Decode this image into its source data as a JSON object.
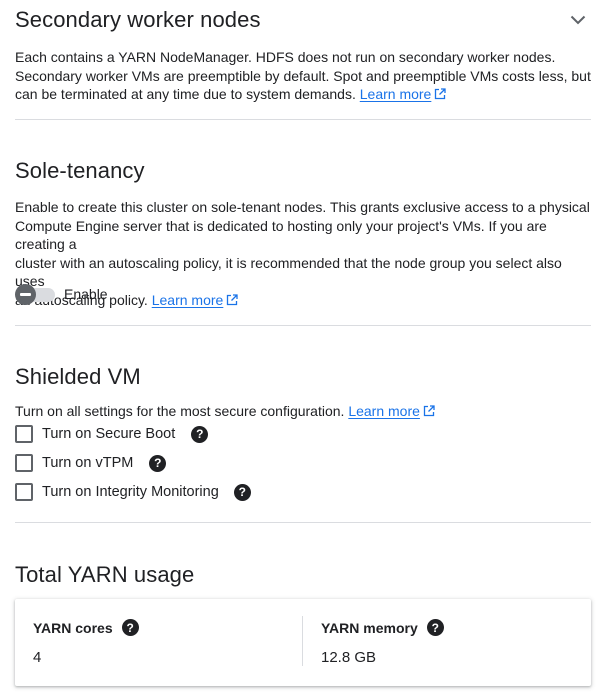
{
  "secondary_workers": {
    "title": "Secondary worker nodes",
    "description_line1": "Each contains a YARN NodeManager. HDFS does not run on secondary worker nodes.",
    "description_line2": "Secondary worker VMs are preemptible by default. Spot and preemptible VMs costs less, but",
    "description_line3": "can be terminated at any time due to system demands.",
    "learn_more": "Learn more"
  },
  "sole_tenancy": {
    "title": "Sole-tenancy",
    "description_line1": "Enable to create this cluster on sole-tenant nodes. This grants exclusive access to a physical",
    "description_line2": "Compute Engine server that is dedicated to hosting only your project's VMs. If you are creating a",
    "description_line3": "cluster with an autoscaling policy, it is recommended that the node group you select also uses",
    "description_line4": "an autoscaling policy.",
    "learn_more": "Learn more",
    "toggle_label": "Enable",
    "enabled": false
  },
  "shielded_vm": {
    "title": "Shielded VM",
    "description": "Turn on all settings for the most secure configuration.",
    "learn_more": "Learn more",
    "options": [
      {
        "label": "Turn on Secure Boot",
        "checked": false
      },
      {
        "label": "Turn on vTPM",
        "checked": false
      },
      {
        "label": "Turn on Integrity Monitoring",
        "checked": false
      }
    ]
  },
  "yarn_usage": {
    "title": "Total YARN usage",
    "cores_label": "YARN cores",
    "cores_value": "4",
    "memory_label": "YARN memory",
    "memory_value": "12.8 GB"
  },
  "icons": {
    "collapse": "chevron-down-icon",
    "external_link": "external-link-icon",
    "help": "help-icon"
  },
  "colors": {
    "link": "#1a73e8",
    "text": "#202124",
    "divider": "#dadce0",
    "toggle_knob": "#5f6368"
  }
}
